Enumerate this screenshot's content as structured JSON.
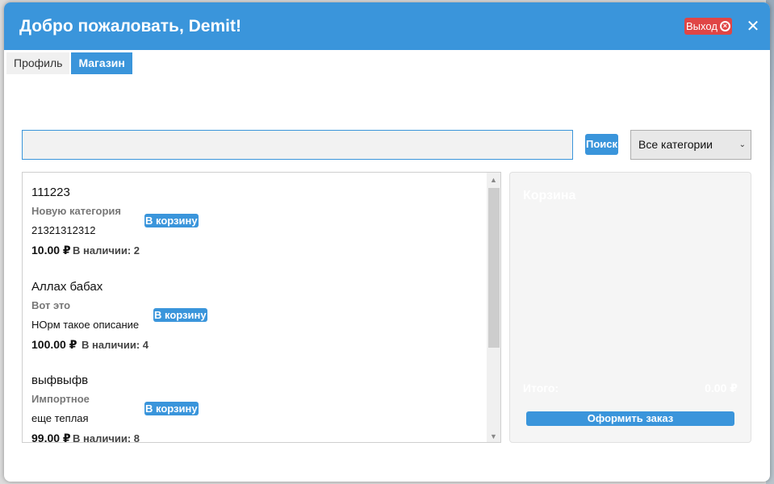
{
  "window": {
    "title": "Добро пожаловать, Demit!",
    "logout_label": "Выход"
  },
  "tabs": [
    {
      "label": "Профиль",
      "active": false
    },
    {
      "label": "Магазин",
      "active": true
    }
  ],
  "search": {
    "value": "",
    "button_label": "Поиск"
  },
  "category_filter": {
    "selected": "Все категории"
  },
  "products": [
    {
      "name": "111223",
      "category": "Новую категория",
      "description": "21321312312",
      "price": "10.00 ₽",
      "stock": "В наличии: 2",
      "cart_label": "В корзину"
    },
    {
      "name": "Аллах бабах",
      "category": "Вот это",
      "description": "НОрм такое описание",
      "price": "100.00 ₽",
      "stock": "В наличии: 4",
      "cart_label": "В корзину"
    },
    {
      "name": "выфвыфв",
      "category": "Импортное",
      "description": "еще теплая",
      "price": "99.00 ₽",
      "stock": "В наличии: 8",
      "cart_label": "В корзину"
    }
  ],
  "cart": {
    "title": "Корзина",
    "total_label": "Итого:",
    "total_value": "0.00 ₽",
    "checkout_label": "Оформить заказ"
  },
  "colors": {
    "accent": "#3a95db",
    "danger": "#e04545"
  }
}
